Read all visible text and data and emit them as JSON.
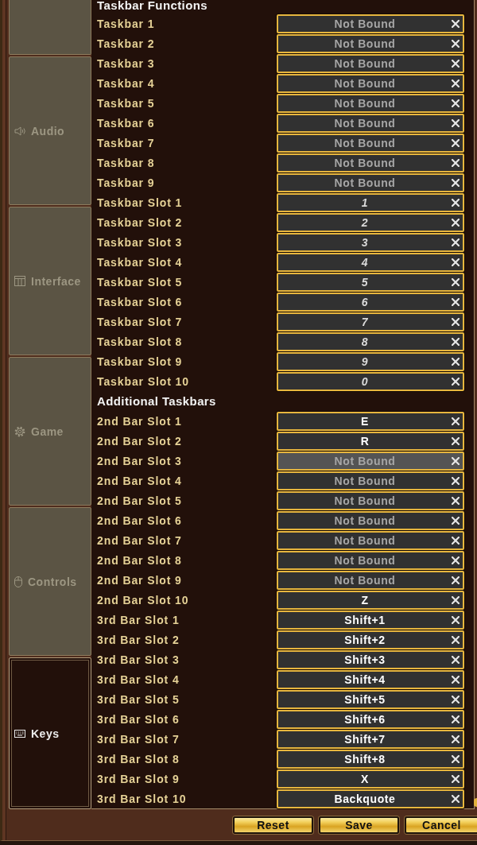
{
  "sidebar": {
    "tabs": [
      {
        "selected": false
      },
      {
        "kind": "audio",
        "label": "Audio",
        "selected": false
      },
      {
        "kind": "interface",
        "label": "Interface",
        "selected": false
      },
      {
        "kind": "game",
        "label": "Game",
        "selected": false
      },
      {
        "kind": "controls",
        "label": "Controls",
        "selected": false
      },
      {
        "kind": "keys",
        "label": "Keys",
        "selected": true
      }
    ]
  },
  "sections": [
    {
      "heading": "Taskbar Functions",
      "bindings": [
        {
          "action": "Taskbar 1",
          "placeholder": "Not Bound",
          "kind": "unbound",
          "highlighted": false
        },
        {
          "action": "Taskbar 2",
          "placeholder": "Not Bound",
          "kind": "unbound",
          "highlighted": false
        },
        {
          "action": "Taskbar 3",
          "placeholder": "Not Bound",
          "kind": "unbound",
          "highlighted": false
        },
        {
          "action": "Taskbar 4",
          "placeholder": "Not Bound",
          "kind": "unbound",
          "highlighted": false
        },
        {
          "action": "Taskbar 5",
          "placeholder": "Not Bound",
          "kind": "unbound",
          "highlighted": false
        },
        {
          "action": "Taskbar 6",
          "placeholder": "Not Bound",
          "kind": "unbound",
          "highlighted": false
        },
        {
          "action": "Taskbar 7",
          "placeholder": "Not Bound",
          "kind": "unbound",
          "highlighted": false
        },
        {
          "action": "Taskbar 8",
          "placeholder": "Not Bound",
          "kind": "unbound",
          "highlighted": false
        },
        {
          "action": "Taskbar 9",
          "placeholder": "Not Bound",
          "kind": "unbound",
          "highlighted": false
        },
        {
          "action": "Taskbar Slot 1",
          "value": "1",
          "kind": "default",
          "highlighted": false
        },
        {
          "action": "Taskbar Slot 2",
          "value": "2",
          "kind": "default",
          "highlighted": false
        },
        {
          "action": "Taskbar Slot 3",
          "value": "3",
          "kind": "default",
          "highlighted": false
        },
        {
          "action": "Taskbar Slot 4",
          "value": "4",
          "kind": "default",
          "highlighted": false
        },
        {
          "action": "Taskbar Slot 5",
          "value": "5",
          "kind": "default",
          "highlighted": false
        },
        {
          "action": "Taskbar Slot 6",
          "value": "6",
          "kind": "default",
          "highlighted": false
        },
        {
          "action": "Taskbar Slot 7",
          "value": "7",
          "kind": "default",
          "highlighted": false
        },
        {
          "action": "Taskbar Slot 8",
          "value": "8",
          "kind": "default",
          "highlighted": false
        },
        {
          "action": "Taskbar Slot 9",
          "value": "9",
          "kind": "default",
          "highlighted": false
        },
        {
          "action": "Taskbar Slot 10",
          "value": "0",
          "kind": "default",
          "highlighted": false
        }
      ]
    },
    {
      "heading": "Additional Taskbars",
      "bindings": [
        {
          "action": "2nd Bar Slot 1",
          "value": "E",
          "kind": "custom",
          "highlighted": false
        },
        {
          "action": "2nd Bar Slot 2",
          "value": "R",
          "kind": "custom",
          "highlighted": false
        },
        {
          "action": "2nd Bar Slot 3",
          "placeholder": "Not Bound",
          "kind": "unbound",
          "highlighted": true
        },
        {
          "action": "2nd Bar Slot 4",
          "placeholder": "Not Bound",
          "kind": "unbound",
          "highlighted": false
        },
        {
          "action": "2nd Bar Slot 5",
          "placeholder": "Not Bound",
          "kind": "unbound",
          "highlighted": false
        },
        {
          "action": "2nd Bar Slot 6",
          "placeholder": "Not Bound",
          "kind": "unbound",
          "highlighted": false
        },
        {
          "action": "2nd Bar Slot 7",
          "placeholder": "Not Bound",
          "kind": "unbound",
          "highlighted": false
        },
        {
          "action": "2nd Bar Slot 8",
          "placeholder": "Not Bound",
          "kind": "unbound",
          "highlighted": false
        },
        {
          "action": "2nd Bar Slot 9",
          "placeholder": "Not Bound",
          "kind": "unbound",
          "highlighted": false
        },
        {
          "action": "2nd Bar Slot 10",
          "value": "Z",
          "kind": "custom",
          "highlighted": false
        },
        {
          "action": "3rd Bar Slot 1",
          "value": "Shift+1",
          "kind": "custom",
          "highlighted": false
        },
        {
          "action": "3rd Bar Slot 2",
          "value": "Shift+2",
          "kind": "custom",
          "highlighted": false
        },
        {
          "action": "3rd Bar Slot 3",
          "value": "Shift+3",
          "kind": "custom",
          "highlighted": false
        },
        {
          "action": "3rd Bar Slot 4",
          "value": "Shift+4",
          "kind": "custom",
          "highlighted": false
        },
        {
          "action": "3rd Bar Slot 5",
          "value": "Shift+5",
          "kind": "custom",
          "highlighted": false
        },
        {
          "action": "3rd Bar Slot 6",
          "value": "Shift+6",
          "kind": "custom",
          "highlighted": false
        },
        {
          "action": "3rd Bar Slot 7",
          "value": "Shift+7",
          "kind": "custom",
          "highlighted": false
        },
        {
          "action": "3rd Bar Slot 8",
          "value": "Shift+8",
          "kind": "custom",
          "highlighted": false
        },
        {
          "action": "3rd Bar Slot 9",
          "value": "X",
          "kind": "custom",
          "highlighted": false
        },
        {
          "action": "3rd Bar Slot 10",
          "value": "Backquote",
          "kind": "custom",
          "highlighted": false
        }
      ]
    }
  ],
  "buttons": [
    "Reset",
    "Save",
    "Cancel"
  ]
}
